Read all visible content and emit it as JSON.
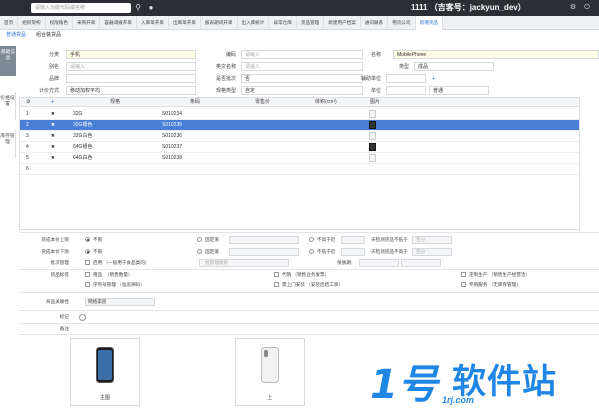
{
  "topbar": {
    "search_placeholder": "请输入功能代码或名称",
    "user": "1111 （吉客号：jackyun_dev）"
  },
  "tabs": [
    {
      "label": "首页"
    },
    {
      "label": "组织架构"
    },
    {
      "label": "权限角色"
    },
    {
      "label": "采购开单"
    },
    {
      "label": "容器调拨开单"
    },
    {
      "label": "入库单开单"
    },
    {
      "label": "出库单开单"
    },
    {
      "label": "报表期间开单"
    },
    {
      "label": "出入库统计"
    },
    {
      "label": "异常仓库"
    },
    {
      "label": "货品管理"
    },
    {
      "label": "新建用户档案"
    },
    {
      "label": "通讯联系"
    },
    {
      "label": "物流公司"
    },
    {
      "label": "新增货品"
    }
  ],
  "subtabs": [
    "普通货品",
    "组合装货品"
  ],
  "left_nav": [
    "基础信息",
    "价格设置",
    "库存管理"
  ],
  "form": {
    "category_label": "分类",
    "category_value": "手机",
    "code_label": "编码",
    "code_placeholder": "请输入",
    "name_label": "名称",
    "name_value": "MobilePhone",
    "alias_label": "别名",
    "alias_placeholder": "请输入",
    "eng_name_label": "英文名称",
    "eng_name_placeholder": "请输入",
    "type_label": "类型",
    "type_value": "成品",
    "brand_label": "品牌",
    "brand_value": "",
    "batch_label": "是否批次",
    "batch_value": "否",
    "aux_unit_label": "辅助单位",
    "aux_unit_value": "",
    "costing_label": "计价方式",
    "costing_value": "移动加权平均",
    "spec_type_label": "规格类型",
    "spec_type_value": "自定",
    "unit_label": "单位",
    "unit_value": "",
    "status_label": "",
    "status_value": "普通"
  },
  "grid": {
    "headers": [
      "规格",
      "条码",
      "零售价",
      "体积(cm³)",
      "图片"
    ],
    "rows": [
      {
        "no": "1",
        "spec": "32G",
        "code": "S010234",
        "img": "light"
      },
      {
        "no": "2",
        "spec": "32G银色",
        "code": "S010235",
        "img": "dark"
      },
      {
        "no": "3",
        "spec": "32G白色",
        "code": "S010236",
        "img": "light"
      },
      {
        "no": "4",
        "spec": "64G银色",
        "code": "S010237",
        "img": "dark"
      },
      {
        "no": "5",
        "spec": "64G白色",
        "code": "S010238",
        "img": "light"
      },
      {
        "no": "6",
        "spec": "",
        "code": "",
        "img": ""
      }
    ]
  },
  "props": {
    "r1_label": "货成本价上限",
    "r1_opt": "不限",
    "r1_mid": "固定值",
    "r1_right": "不高于近",
    "r1_right2": "天检测货品不低于",
    "r1_tail": "百分",
    "r2_label": "货成本价下限",
    "r2_opt": "不限",
    "r2_mid": "固定值",
    "r2_right": "不低于近",
    "r2_right2": "天检测货品不高于",
    "r2_tail": "百分",
    "r3_label": "批次管理",
    "r3_opt": "启用 （一般用于食品类的）",
    "r3_mid": "批管理规则",
    "r3_right": "保质期：",
    "r4_label": "货品标签",
    "r4_a": "赠品",
    "r4_a2": "（销售数量）",
    "r4_b": "代销 （销售业务发票）",
    "r4_c": "定制生产 （销售生产经营活）",
    "r5_a": "序列号管理 （准追溯码）",
    "r5_b": "需上门安装 （安装后结工单）",
    "r5_c": "专销服务 （无库存管理）",
    "r6_label": "商品关联性",
    "r6_value": "网络渠道",
    "r7_label": "标记",
    "r8_label": "备注"
  },
  "photos": [
    {
      "caption": "主图"
    },
    {
      "caption": "上"
    }
  ],
  "watermark": {
    "number": "1号",
    "text": "软件站",
    "url": "1rj.com"
  }
}
